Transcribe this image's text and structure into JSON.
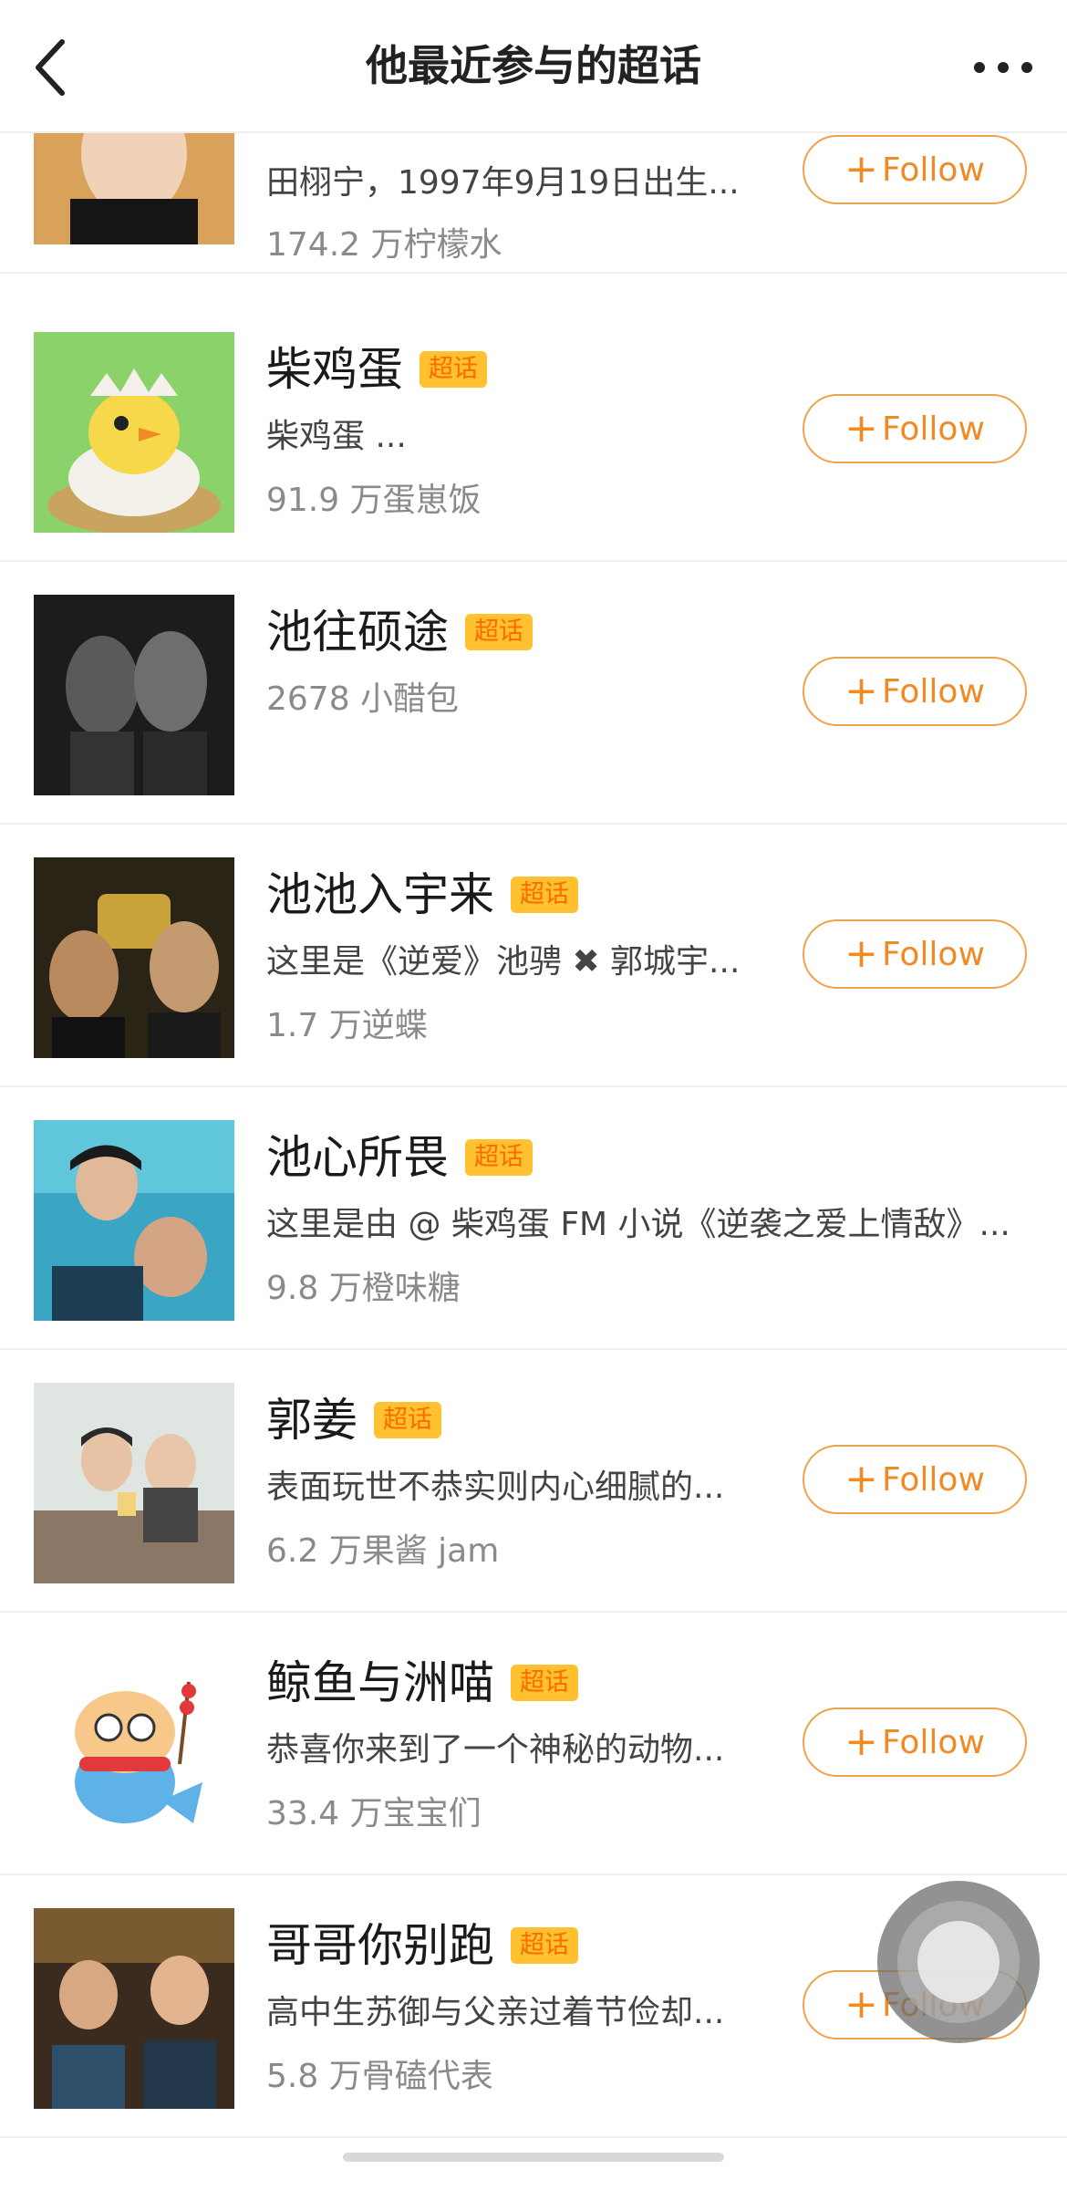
{
  "header": {
    "title": "他最近参与的超话"
  },
  "colors": {
    "accent": "#f08a24",
    "badge_bg": "#ffc130",
    "badge_text": "#ff6a00"
  },
  "items": [
    {
      "name": "",
      "badge": "",
      "desc": "田栩宁，1997年9月19日出生...",
      "count": "174.2 万柠檬水",
      "follow": "Follow"
    },
    {
      "name": "柴鸡蛋",
      "badge": "超话",
      "desc": "柴鸡蛋 ...",
      "count": "91.9 万蛋崽饭",
      "follow": "Follow"
    },
    {
      "name": "池往硕途",
      "badge": "超话",
      "desc": "",
      "count": "2678 小醋包",
      "follow": "Follow"
    },
    {
      "name": "池池入宇来",
      "badge": "超话",
      "desc": "这里是《逆爱》池骋 ✖ 郭城宇...",
      "count": "1.7 万逆蝶",
      "follow": "Follow"
    },
    {
      "name": "池心所畏",
      "badge": "超话",
      "desc": "这里是由 @ 柴鸡蛋 FM 小说《逆袭之爱上情敌》...",
      "count": "9.8 万橙味糖",
      "follow": ""
    },
    {
      "name": "郭姜",
      "badge": "超话",
      "desc": "表面玩世不恭实则内心细腻的...",
      "count": "6.2 万果酱 jam",
      "follow": "Follow"
    },
    {
      "name": "鲸鱼与洲喵",
      "badge": "超话",
      "desc": "恭喜你来到了一个神秘的动物...",
      "count": "33.4 万宝宝们",
      "follow": "Follow"
    },
    {
      "name": "哥哥你别跑",
      "badge": "超话",
      "desc": "高中生苏御与父亲过着节俭却...",
      "count": "5.8 万骨磕代表",
      "follow": "Follow"
    }
  ]
}
